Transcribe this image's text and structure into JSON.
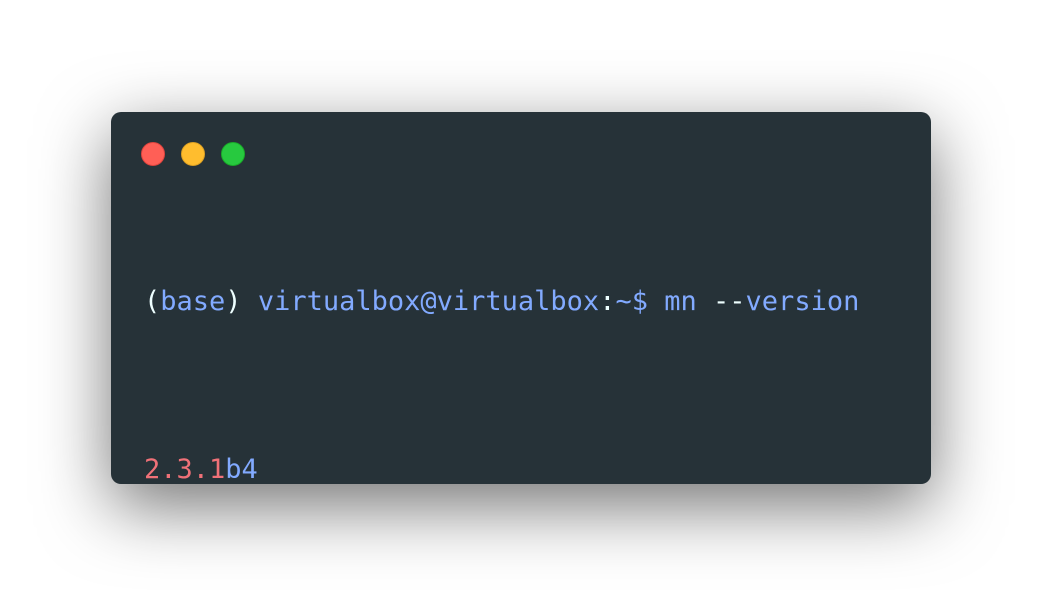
{
  "window": {
    "controls": [
      {
        "name": "close",
        "color": "#ff5f56"
      },
      {
        "name": "minimize",
        "color": "#ffbd2e"
      },
      {
        "name": "maximize",
        "color": "#27c93f"
      }
    ],
    "background": "#263238"
  },
  "terminal": {
    "prompt": {
      "open_paren": "(",
      "env": "base",
      "close_paren": ")",
      "space1": " ",
      "user_host": "virtualbox@virtualbox",
      "colon": ":",
      "path_sign": "~$",
      "space2": " ",
      "command": "mn",
      "space3": " ",
      "flag_dashes": "--",
      "flag": "version"
    },
    "output": {
      "version_number": "2.3.1",
      "version_suffix": "b4"
    }
  },
  "colors": {
    "text_default": "#eeffff",
    "text_blue": "#82aaff",
    "text_red": "#f07178"
  }
}
